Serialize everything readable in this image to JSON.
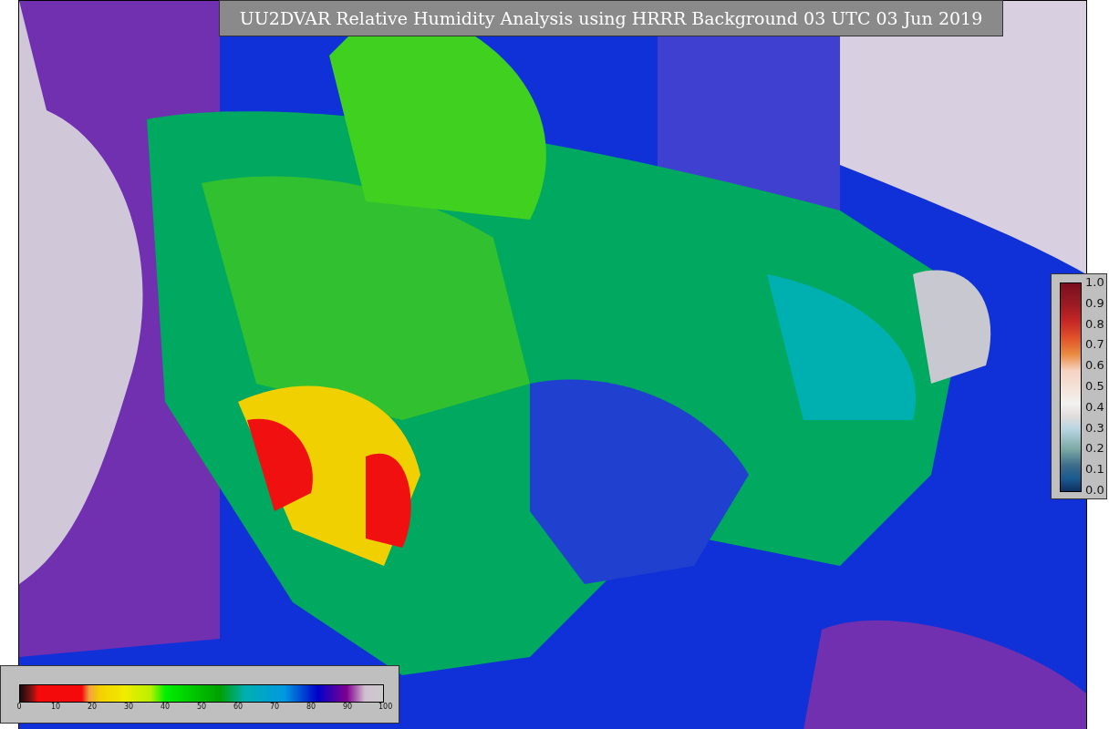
{
  "title": "UU2DVAR Relative Humidity Analysis using HRRR Background 03 UTC 03 Jun 2019",
  "station_colorbar": {
    "ticks": [
      "1.0",
      "0.9",
      "0.8",
      "0.7",
      "0.6",
      "0.5",
      "0.4",
      "0.3",
      "0.2",
      "0.1",
      "0.0"
    ]
  },
  "humidity_colorbar": {
    "ticks": [
      "0",
      "10",
      "20",
      "30",
      "40",
      "50",
      "60",
      "70",
      "80",
      "90",
      "100"
    ]
  }
}
